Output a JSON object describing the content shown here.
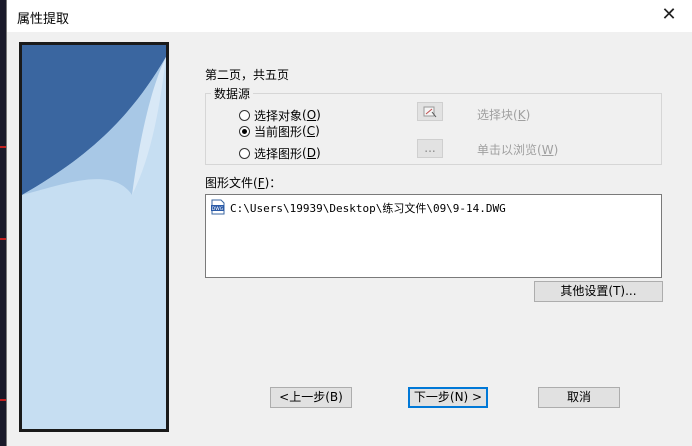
{
  "window": {
    "title": "属性提取",
    "close_glyph": "✕"
  },
  "page_indicator": "第二页，共五页",
  "data_source": {
    "legend": "数据源",
    "options": [
      {
        "label": "选择对象",
        "mnemonic": "O",
        "selected": false
      },
      {
        "label": "当前图形",
        "mnemonic": "C",
        "selected": true
      },
      {
        "label": "选择图形",
        "mnemonic": "D",
        "selected": false
      }
    ],
    "select_block_button_icon": "select-block-icon",
    "select_block_label": "选择块",
    "select_block_mnemonic": "K",
    "browse_button_label": "...",
    "browse_label": "单击以浏览",
    "browse_mnemonic": "W"
  },
  "drawing_files": {
    "label": "图形文件",
    "mnemonic": "F",
    "suffix": "：",
    "items": [
      {
        "icon": "dwg-file-icon",
        "icon_text": "DWG",
        "path": "C:\\Users\\19939\\Desktop\\练习文件\\09\\9-14.DWG"
      }
    ]
  },
  "buttons": {
    "other_settings": "其他设置(T)...",
    "back": "<上一步(B)",
    "next": "下一步(N) >",
    "cancel": "取消"
  },
  "colors": {
    "panel_dark": "#3a66a0",
    "panel_light": "#c6def2",
    "accent": "#0078d7"
  }
}
